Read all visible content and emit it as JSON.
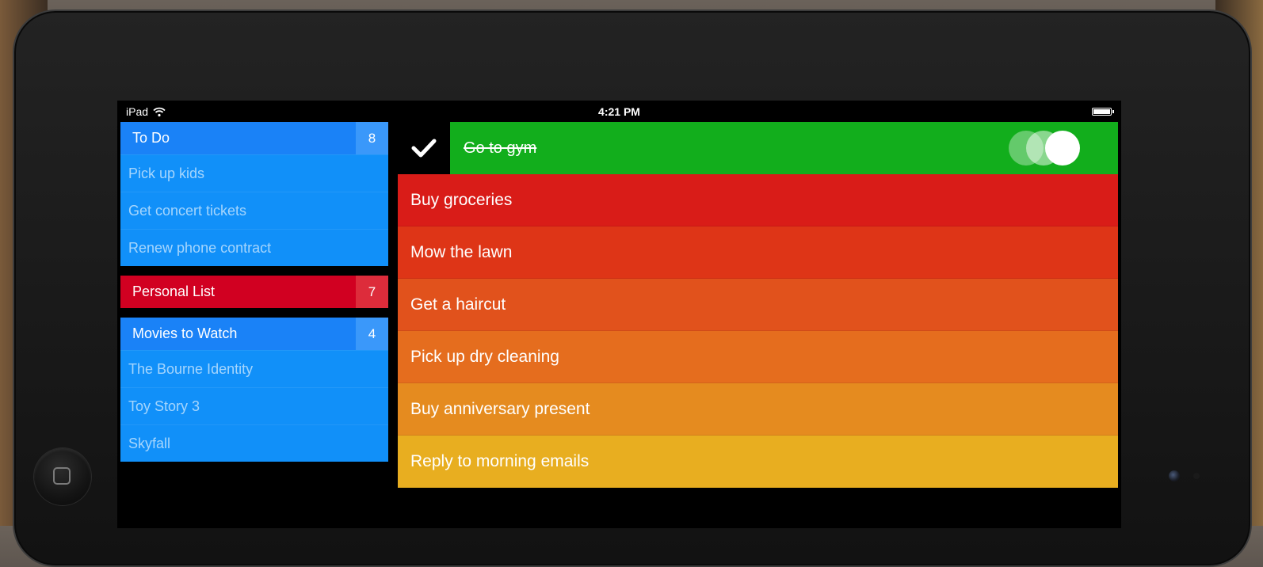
{
  "colors": {
    "blue_header": "#1a82f7",
    "blue_item": "#1190f9",
    "blue_count": "#3a98fa",
    "red_header": "#d10021",
    "red_count": "#dd2c3b",
    "active_green": "#12ae1c",
    "task_colors": [
      "#d91c18",
      "#de3517",
      "#e1521c",
      "#e56d1e",
      "#e58b1f",
      "#e8ae20"
    ]
  },
  "status_bar": {
    "device": "iPad",
    "time": "4:21 PM",
    "icons": [
      "wifi-icon",
      "battery-icon"
    ]
  },
  "lists": [
    {
      "name": "To Do",
      "count": "8",
      "color": "blue",
      "items": [
        "Pick up kids",
        "Get concert tickets",
        "Renew phone contract"
      ]
    },
    {
      "name": "Personal List",
      "count": "7",
      "color": "red",
      "items": []
    },
    {
      "name": "Movies to Watch",
      "count": "4",
      "color": "blue",
      "items": [
        "The Bourne Identity",
        "Toy Story 3",
        "Skyfall"
      ]
    }
  ],
  "active_task": {
    "label": "Go to gym",
    "completed": true,
    "icon": "checkmark-icon"
  },
  "tasks": [
    "Buy groceries",
    "Mow the lawn",
    "Get a haircut",
    "Pick up dry cleaning",
    "Buy anniversary present",
    "Reply to morning emails"
  ],
  "device_buttons": {
    "home_icon": "square-icon"
  }
}
